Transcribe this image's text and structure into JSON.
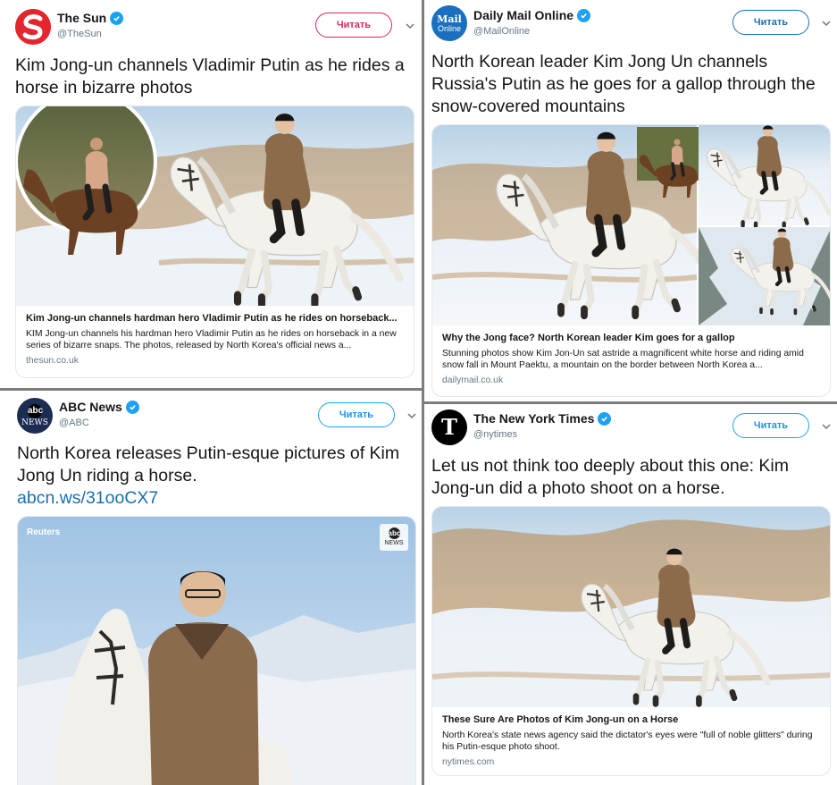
{
  "follow_label": "Читать",
  "tweets": {
    "sun": {
      "name": "The Sun",
      "handle": "@TheSun",
      "text": "Kim Jong-un channels Vladimir Putin as he rides a horse in bizarre photos",
      "card": {
        "title": "Kim Jong-un channels hardman hero Vladimir Putin as he rides on horseback...",
        "desc": "KIM Jong-un channels his hardman hero Vladimir Putin as he rides on horseback in a new series of bizarre snaps. The photos, released by North Korea's official news a...",
        "domain": "thesun.co.uk"
      }
    },
    "dm": {
      "name": "Daily Mail Online",
      "handle": "@MailOnline",
      "logo_top": "Mail",
      "logo_bottom": "Online",
      "text": "North Korean leader Kim Jong Un channels Russia's Putin as he goes for a gallop through the snow-covered mountains",
      "card": {
        "title": "Why the Jong face? North Korean leader Kim goes for a gallop",
        "desc": "Stunning photos show Kim Jon-Un sat astride a magnificent white horse and riding amid snow fall in Mount Paektu, a mountain on the border between North Korea a...",
        "domain": "dailymail.co.uk"
      }
    },
    "abc": {
      "name": "ABC News",
      "handle": "@ABC",
      "logo_top": "abc",
      "logo_bottom": "NEWS",
      "text": "North Korea releases Putin-esque pictures of Kim Jong Un riding a horse.",
      "link": "abcn.ws/31ooCX7",
      "media_source": "Reuters",
      "watermark_top": "abc",
      "watermark_bottom": "NEWS"
    },
    "nyt": {
      "name": "The New York Times",
      "handle": "@nytimes",
      "logo": "T",
      "text": "Let us not think too deeply about this one: Kim Jong-un did a photo shoot on a horse.",
      "card": {
        "title": "These Sure Are Photos of Kim Jong-un on a Horse",
        "desc": "North Korea's state news agency said the dictator's eyes were \"full of noble glitters\" during his Putin-esque photo shoot.",
        "domain": "nytimes.com"
      }
    }
  },
  "colors": {
    "verified": "#1da1f2",
    "sun_red": "#e0245e",
    "divider": "#7d7d7d",
    "link": "#1b6fa8"
  }
}
